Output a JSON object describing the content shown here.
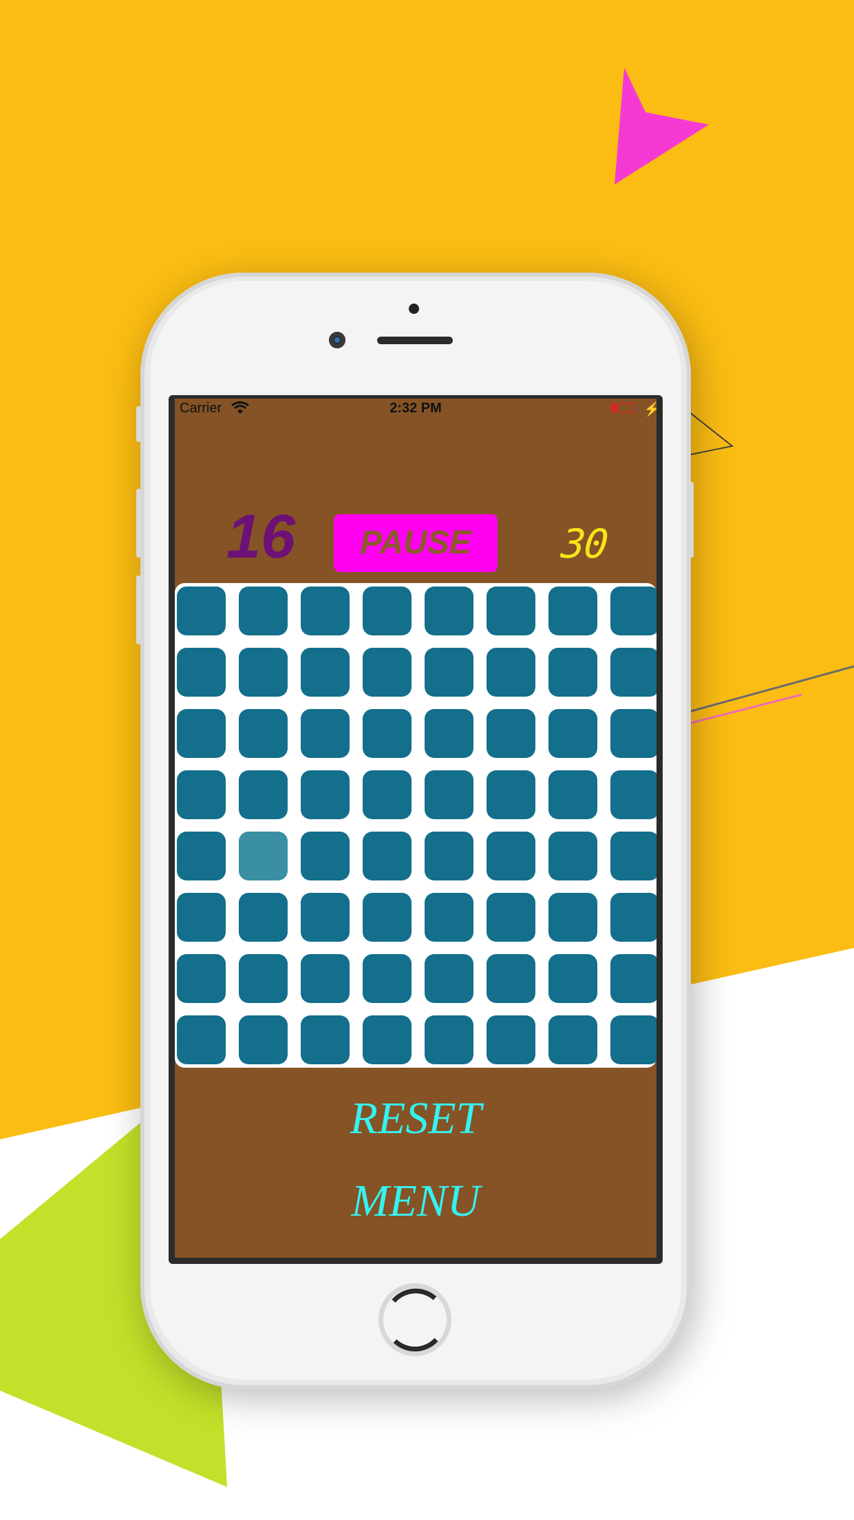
{
  "status_bar": {
    "carrier": "Carrier",
    "time": "2:32 PM"
  },
  "game": {
    "score": "16",
    "pause_label": "PAUSE",
    "timer": "30",
    "grid": {
      "rows": 8,
      "cols": 8,
      "highlighted": [
        {
          "row": 4,
          "col": 1
        }
      ]
    }
  },
  "menu": {
    "reset_label": "RESET",
    "menu_label": "MENU"
  },
  "colors": {
    "background": "#fbbd13",
    "screen_background": "#855325",
    "tile": "#136f8b",
    "tile_highlighted": "#3a8fa3",
    "pause_button": "#ff00f0",
    "score": "#6d1177",
    "timer": "#f7e51a",
    "menu_text": "#35f2f2"
  }
}
